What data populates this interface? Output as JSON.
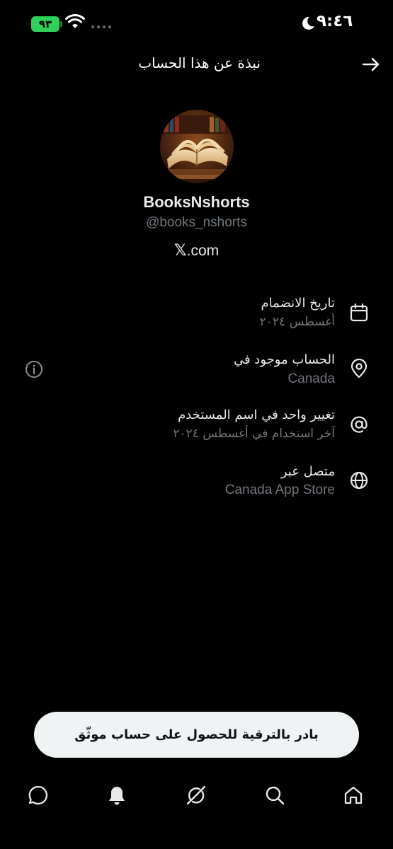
{
  "status_bar": {
    "time": "٩:٤٦",
    "battery": "٩٣"
  },
  "header": {
    "title": "نبذة عن هذا الحساب"
  },
  "profile": {
    "display_name": "BooksNshorts",
    "handle": "@books_nshorts",
    "site_mark": "𝕏",
    "site_suffix": ".com"
  },
  "info": [
    {
      "title": "تاريخ الانضمام",
      "value": "أغسطس ٢٠٢٤",
      "icon": "calendar-icon"
    },
    {
      "title": "الحساب موجود في",
      "value": "Canada",
      "icon": "location-pin-icon"
    },
    {
      "title": "تغيير واحد في اسم المستخدم",
      "value": "آخر استخدام في أغسطس ٢٠٢٤",
      "icon": "at-sign-icon"
    },
    {
      "title": "متصل عبر",
      "value": "Canada App Store",
      "icon": "globe-icon"
    }
  ],
  "upgrade": {
    "label": "بادر بالترقية للحصول على حساب موثّق"
  },
  "nav": {
    "items": [
      "home-icon",
      "search-icon",
      "grok-icon",
      "notifications-icon",
      "messages-icon"
    ]
  },
  "colors": {
    "background": "#000000",
    "text_primary": "#e7e9ea",
    "text_secondary": "#71767b",
    "battery": "#30d158",
    "button_bg": "#eff3f4"
  }
}
